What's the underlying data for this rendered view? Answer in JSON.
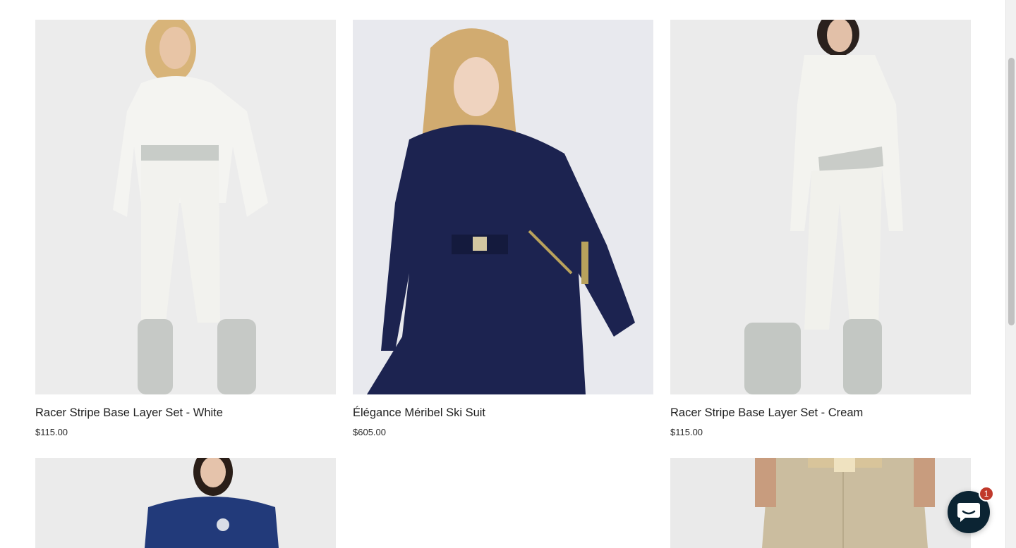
{
  "products": [
    {
      "title": "Racer Stripe Base Layer Set - White",
      "price": "$115.00",
      "image": "model-white-base-layer"
    },
    {
      "title": "Élégance Méribel Ski Suit",
      "price": "$605.00",
      "image": "model-navy-ski-suit"
    },
    {
      "title": "Racer Stripe Base Layer Set - Cream",
      "price": "$115.00",
      "image": "model-cream-base-layer"
    }
  ],
  "row2": [
    {
      "image": "model-navy-top"
    },
    {
      "image": "beige-ski-pants"
    }
  ],
  "chat": {
    "badge": "1",
    "icon": "chat-icon"
  },
  "colors": {
    "accent": "#0b2433",
    "badge": "#c0392b",
    "image_bg": "#e9e9eb"
  }
}
